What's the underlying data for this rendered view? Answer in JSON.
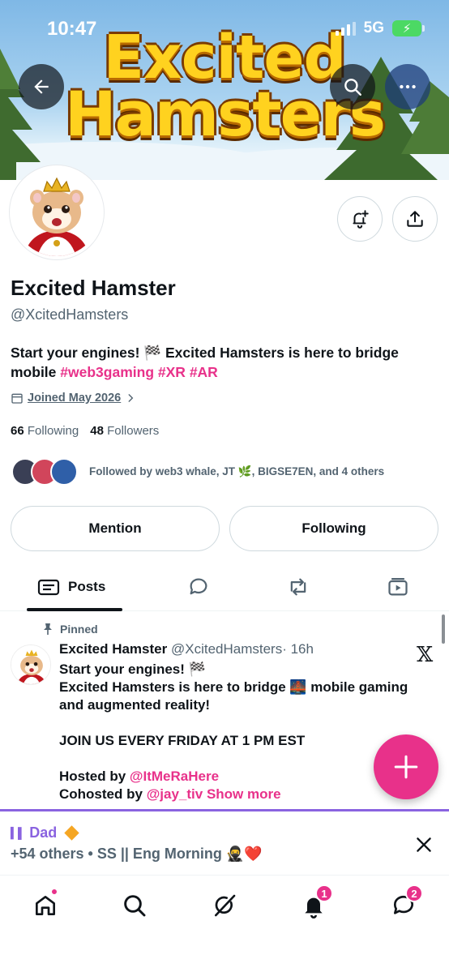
{
  "status_bar": {
    "time": "10:47",
    "network": "5G"
  },
  "banner": {
    "line1": "Excited",
    "line2": "Hamsters"
  },
  "profile": {
    "name": "Excited Hamster",
    "handle": "@XcitedHamsters",
    "bio_text": "Start your engines! 🏁 Excited Hamsters is here to bridge mobile",
    "bio_tags": [
      "#web3gaming",
      "#XR",
      "#AR"
    ],
    "joined": "Joined May 2026",
    "following_count": "66",
    "following_label": "Following",
    "followers_count": "48",
    "followers_label": "Followers",
    "followed_by": "Followed by web3 whale, JT 🌿, BIGSE7EN, and 4 others"
  },
  "actions": {
    "mention": "Mention",
    "following": "Following"
  },
  "tabs": {
    "posts": "Posts"
  },
  "pinned_post": {
    "pinned_label": "Pinned",
    "author": "Excited Hamster",
    "handle": "@XcitedHamsters",
    "time": "· 16h",
    "line1": "Start your engines! 🏁",
    "line2": "Excited Hamsters is here to bridge 🌉 mobile gaming and augmented reality!",
    "line3": "JOIN US EVERY FRIDAY AT 1 PM EST",
    "hosted_label": "Hosted by",
    "hosted_by": "@ItMeRaHere",
    "cohosted_label": "Cohosted by",
    "cohosted_by": "@jay_tiv",
    "show_more": "Show more"
  },
  "space": {
    "host": "Dad",
    "title": "+54 others • SS || Eng Morning 🥷❤️"
  },
  "nav": {
    "notifications_badge": "1",
    "messages_badge": "2"
  },
  "colors": {
    "accent": "#e8318a",
    "space_purple": "#8a63e0",
    "muted": "#536471"
  }
}
